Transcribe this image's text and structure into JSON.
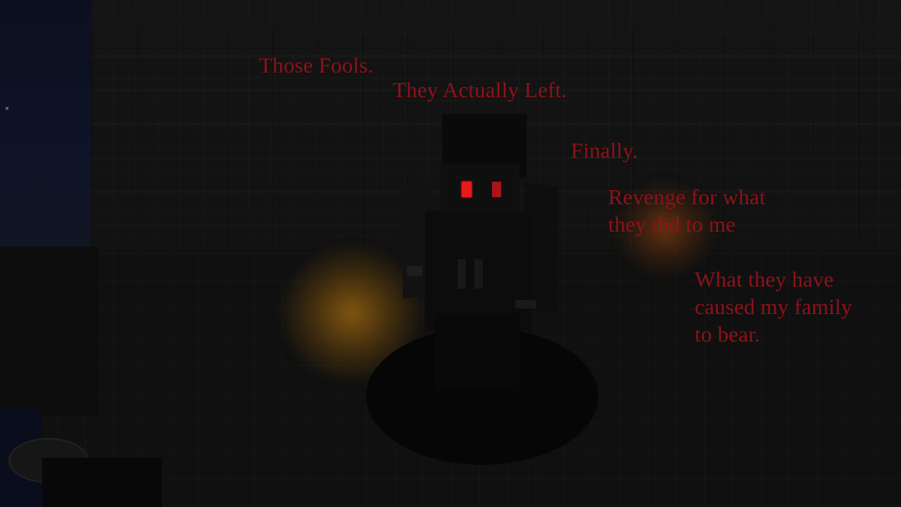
{
  "dialogue": {
    "line1": "Those Fools.",
    "line2": "They Actually Left.",
    "line3": "Finally.",
    "line4a": "Revenge for what",
    "line4b": "they did to me",
    "line5a": "What they have",
    "line5b": "caused my family",
    "line5c": "to bear."
  },
  "colors": {
    "text": "#8e1219",
    "eyes": "#e61a1a",
    "torch_glow": "#96620f"
  }
}
